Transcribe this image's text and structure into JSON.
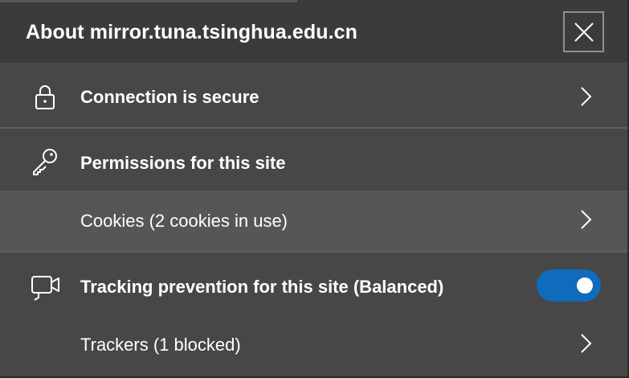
{
  "header": {
    "title": "About mirror.tuna.tsinghua.edu.cn",
    "close_icon": "close-icon"
  },
  "connection": {
    "label": "Connection is secure",
    "icon": "lock-icon"
  },
  "permissions": {
    "label": "Permissions for this site",
    "icon": "key-icon",
    "cookies_label": "Cookies (2 cookies in use)"
  },
  "tracking": {
    "label": "Tracking prevention for this site (Balanced)",
    "icon": "camera-icon",
    "enabled": true,
    "trackers_label": "Trackers (1 blocked)"
  },
  "colors": {
    "accent": "#0f6cbd",
    "panel": "#474747",
    "header": "#3b3b3b",
    "hover_row": "#565656"
  }
}
